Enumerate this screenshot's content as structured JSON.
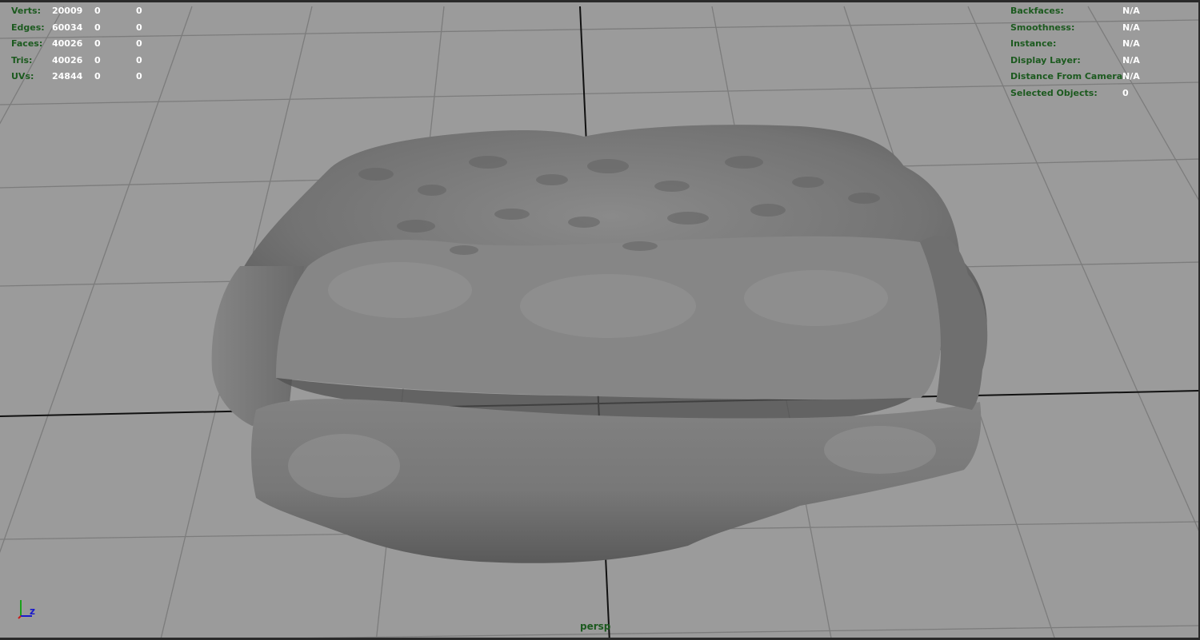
{
  "poly_count": {
    "rows": [
      {
        "label": "Verts:",
        "v1": "20009",
        "v2": "0",
        "v3": "0"
      },
      {
        "label": "Edges:",
        "v1": "60034",
        "v2": "0",
        "v3": "0"
      },
      {
        "label": "Faces:",
        "v1": "40026",
        "v2": "0",
        "v3": "0"
      },
      {
        "label": "Tris:",
        "v1": "40026",
        "v2": "0",
        "v3": "0"
      },
      {
        "label": "UVs:",
        "v1": "24844",
        "v2": "0",
        "v3": "0"
      }
    ]
  },
  "object_details": {
    "rows": [
      {
        "label": "Backfaces:",
        "value": "N/A"
      },
      {
        "label": "Smoothness:",
        "value": "N/A"
      },
      {
        "label": "Instance:",
        "value": "N/A"
      },
      {
        "label": "Display Layer:",
        "value": "N/A"
      },
      {
        "label": "Distance From Camera:",
        "value": "N/A"
      },
      {
        "label": "Selected Objects:",
        "value": "0"
      }
    ]
  },
  "camera": {
    "name": "persp"
  },
  "axis_gizmo": {
    "y_label": "",
    "z_label": "z"
  },
  "colors": {
    "viewport_bg": "#9b9b9b",
    "hud_label": "#1c5a1f",
    "hud_value": "#ffffff",
    "grid_line": "#7c7c7c",
    "axis_line": "#111111",
    "mesh_gray": "#6e6e6e"
  },
  "icons": {
    "axis": "axis-gizmo-icon"
  }
}
